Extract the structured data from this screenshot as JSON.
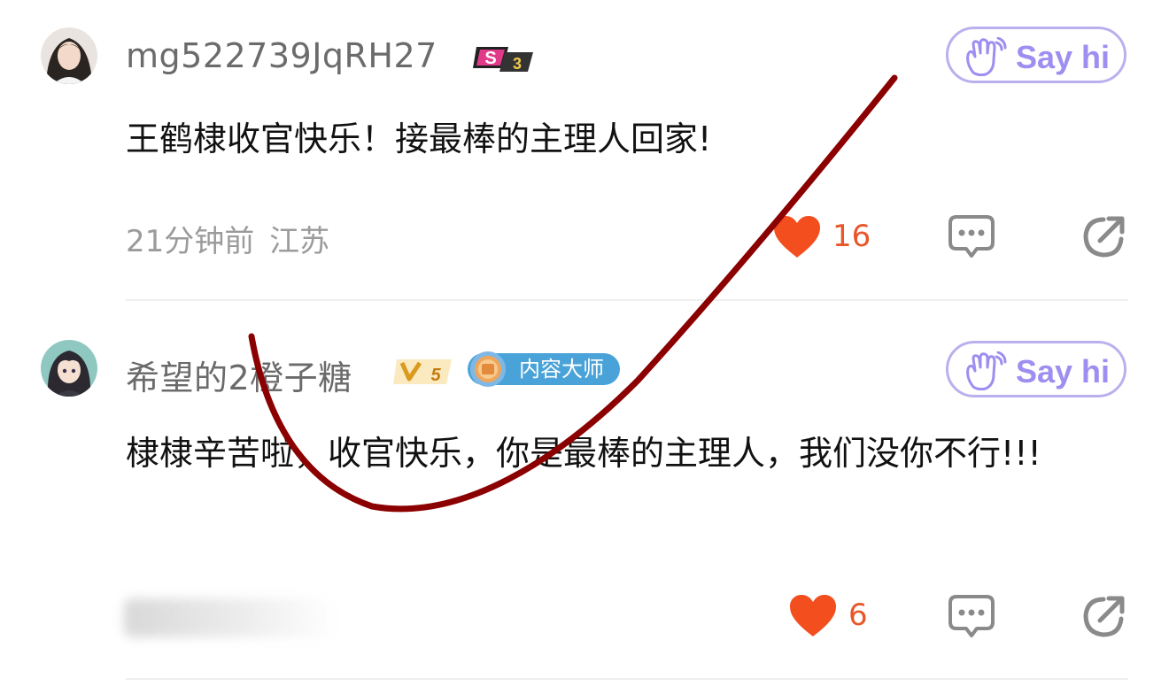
{
  "comments": [
    {
      "username": "mg522739JqRH27",
      "level_badge": "S3",
      "say_hi": "Say hi",
      "text": "王鹤棣收官快乐！接最棒的主理人回家!",
      "time": "21分钟前",
      "location": "江苏",
      "likes": "16"
    },
    {
      "username": "希望的2橙子糖",
      "level_badge": "V5",
      "honor_badge": "内容大师",
      "say_hi": "Say hi",
      "text": "棣棣辛苦啦，收官快乐，你是最棒的主理人，我们没你不行!!!",
      "likes": "6"
    }
  ],
  "icons": [
    "wave-hand-icon",
    "heart-icon",
    "comment-icon",
    "share-icon"
  ],
  "colors": {
    "like": "#f24e1e",
    "say_hi": "#9d8ef0",
    "annotation_stroke": "#8b0000"
  }
}
